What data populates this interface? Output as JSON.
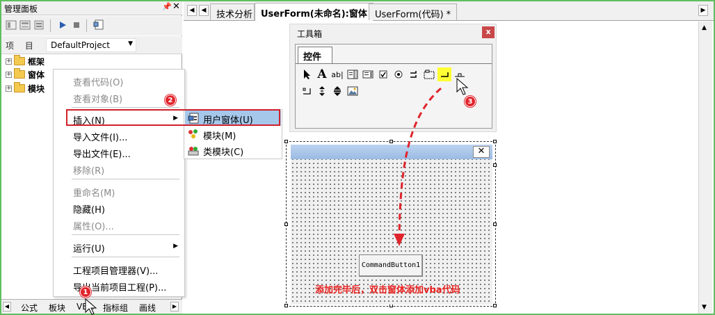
{
  "panel": {
    "title": "管理面板",
    "project_label": "项 目",
    "project_value": "DefaultProject",
    "tree": [
      {
        "label": "框架"
      },
      {
        "label": "窗体"
      },
      {
        "label": "模块"
      }
    ],
    "bottom_tabs": [
      "公式",
      "板块",
      "VBA",
      "指标组",
      "画线"
    ]
  },
  "doc_tabs": [
    "技术分析",
    "UserForm(未命名):窗体",
    "UserForm(代码) *"
  ],
  "context_menu": {
    "items": [
      {
        "label": "查看代码(O)",
        "disabled": true
      },
      {
        "label": "查看对象(B)",
        "disabled": true
      },
      {
        "label": "插入(N)",
        "disabled": false
      },
      {
        "label": "导入文件(I)...",
        "disabled": false
      },
      {
        "label": "导出文件(E)...",
        "disabled": false
      },
      {
        "label": "移除(R)",
        "disabled": true
      },
      {
        "label": "重命名(M)",
        "disabled": true
      },
      {
        "label": "隐藏(H)",
        "disabled": false
      },
      {
        "label": "属性(O)...",
        "disabled": true
      },
      {
        "label": "运行(U)",
        "disabled": false
      },
      {
        "label": "工程项目管理器(V)...",
        "disabled": false
      },
      {
        "label": "导出当前项目工程(P)...",
        "disabled": false
      }
    ]
  },
  "submenu": {
    "items": [
      {
        "label": "用户窗体(U)"
      },
      {
        "label": "模块(M)"
      },
      {
        "label": "类模块(C)"
      }
    ]
  },
  "toolbox": {
    "title": "工具箱",
    "close_label": "x",
    "tab_label": "控件"
  },
  "form": {
    "close_label": "✕",
    "command_button": "CommandButton1"
  },
  "hint": "添加完毕后，双击窗体添加vba代码",
  "badges": [
    "1",
    "2",
    "3"
  ],
  "colors": {
    "accent_red": "#e0242c",
    "submenu_highlight": "#a5c7ea",
    "form_titlebar": "#9bbbe4",
    "tool_highlight": "#ffff33"
  }
}
